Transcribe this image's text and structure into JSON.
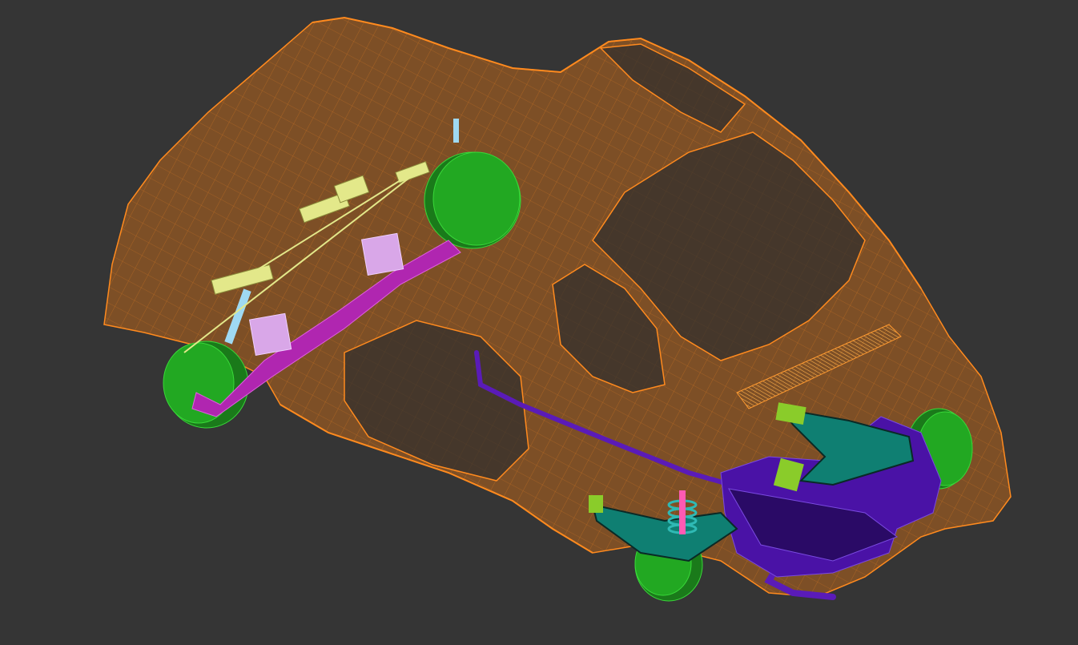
{
  "viewport": {
    "background_color": "#353535"
  },
  "scene": {
    "body_shell": {
      "fill_color": "#b8641a",
      "edge_color": "#ff8a1e"
    },
    "wheel_color": "#22a822",
    "wheel_edge_color": "#39d839",
    "front_suspension": {
      "leaf_spring_color": "#b026b0",
      "spring_clamp_color": "#d9a7e8",
      "damper_color": "#9fd9f2",
      "link_color": "#e3e88a"
    },
    "rear_suspension": {
      "engine_color": "#4a12a6",
      "trailing_arm_color": "#0f7f72",
      "coil_spring_color": "#2fb9b4",
      "bracket_color": "#8acc2a",
      "exhaust_color": "#5a1bb8"
    }
  }
}
